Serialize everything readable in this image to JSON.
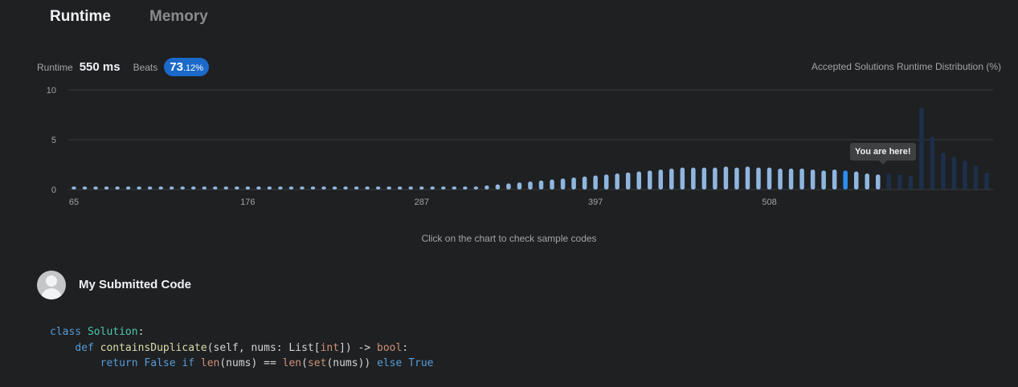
{
  "tabs": [
    {
      "label": "Runtime",
      "active": true
    },
    {
      "label": "Memory",
      "active": false
    }
  ],
  "stats": {
    "runtime_label": "Runtime",
    "runtime_value": "550 ms",
    "beats_label": "Beats",
    "beats_int": "73",
    "beats_frac": ".12%"
  },
  "chart_title": "Accepted Solutions Runtime Distribution (%)",
  "chart_data": {
    "type": "bar",
    "ylim": [
      0,
      10
    ],
    "y_ticks": [
      "10",
      "5",
      "0"
    ],
    "x_tick_labels": [
      "65",
      "176",
      "287",
      "397",
      "508"
    ],
    "values": [
      0.3,
      0.3,
      0.3,
      0.3,
      0.3,
      0.3,
      0.3,
      0.3,
      0.3,
      0.3,
      0.3,
      0.3,
      0.3,
      0.3,
      0.3,
      0.3,
      0.3,
      0.3,
      0.3,
      0.3,
      0.3,
      0.3,
      0.3,
      0.3,
      0.3,
      0.3,
      0.3,
      0.3,
      0.3,
      0.3,
      0.3,
      0.3,
      0.3,
      0.3,
      0.3,
      0.3,
      0.3,
      0.3,
      0.4,
      0.5,
      0.6,
      0.7,
      0.8,
      0.9,
      1.0,
      1.1,
      1.2,
      1.3,
      1.4,
      1.5,
      1.6,
      1.7,
      1.8,
      1.9,
      2.0,
      2.1,
      2.2,
      2.2,
      2.2,
      2.2,
      2.3,
      2.2,
      2.3,
      2.2,
      2.2,
      2.1,
      2.1,
      2.1,
      2.0,
      1.9,
      2.0,
      1.9,
      1.8,
      1.6,
      1.5,
      1.6,
      1.5,
      1.4,
      8.2,
      5.3,
      3.7,
      3.3,
      2.9,
      2.4,
      1.7
    ],
    "highlight_index": 71,
    "cutoff_index": 74,
    "colors": {
      "before": "#90b6df",
      "highlight": "#2d8ef0",
      "after": "#1d2f4a",
      "grid": "#3a3c3e"
    },
    "grid": true
  },
  "tooltip": "You are here!",
  "hint": "Click on the chart to check sample codes",
  "submitted": {
    "heading": "My Submitted Code",
    "code_lines": [
      [
        [
          "kw",
          "class"
        ],
        [
          "txt",
          " "
        ],
        [
          "cls",
          "Solution"
        ],
        [
          "txt",
          ":"
        ]
      ],
      [
        [
          "txt",
          "    "
        ],
        [
          "kw",
          "def"
        ],
        [
          "txt",
          " "
        ],
        [
          "fn",
          "containsDuplicate"
        ],
        [
          "txt",
          "(self, nums: List["
        ],
        [
          "bi",
          "int"
        ],
        [
          "txt",
          "]) -> "
        ],
        [
          "bi",
          "bool"
        ],
        [
          "txt",
          ":"
        ]
      ],
      [
        [
          "txt",
          "        "
        ],
        [
          "kw",
          "return"
        ],
        [
          "txt",
          " "
        ],
        [
          "kw",
          "False"
        ],
        [
          "txt",
          " "
        ],
        [
          "kw",
          "if"
        ],
        [
          "txt",
          " "
        ],
        [
          "bi",
          "len"
        ],
        [
          "txt",
          "(nums) == "
        ],
        [
          "bi",
          "len"
        ],
        [
          "txt",
          "("
        ],
        [
          "bi",
          "set"
        ],
        [
          "txt",
          "(nums)) "
        ],
        [
          "kw",
          "else"
        ],
        [
          "txt",
          " "
        ],
        [
          "kw",
          "True"
        ]
      ]
    ]
  }
}
